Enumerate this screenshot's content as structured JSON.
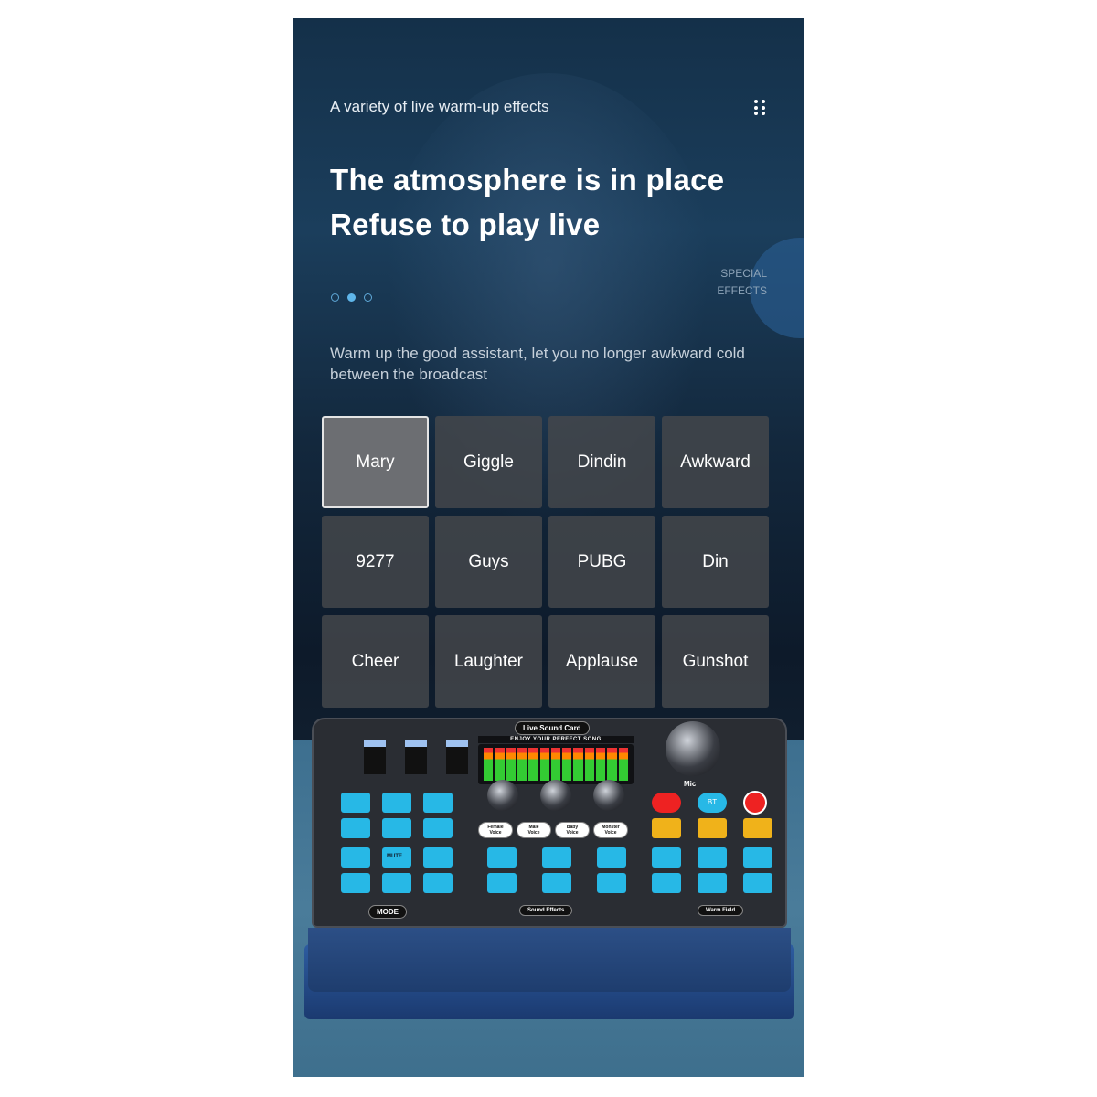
{
  "header": {
    "subtitle": "A variety of live warm-up effects",
    "menu_icon": "grid-dots-icon",
    "title_lines": [
      "The atmosphere is in place",
      "Refuse to play live"
    ],
    "side_label": [
      "SPECIAL",
      "EFFECTS"
    ],
    "carousel": {
      "count": 3,
      "active": 2
    },
    "description": "Warm up the good assistant, let you no longer awkward cold between the broadcast"
  },
  "effects": [
    {
      "label": "Mary",
      "selected": true
    },
    {
      "label": "Giggle"
    },
    {
      "label": "Dindin"
    },
    {
      "label": "Awkward"
    },
    {
      "label": "9277"
    },
    {
      "label": "Guys"
    },
    {
      "label": "PUBG"
    },
    {
      "label": "Din"
    },
    {
      "label": "Cheer"
    },
    {
      "label": "Laughter"
    },
    {
      "label": "Applause"
    },
    {
      "label": "Gunshot"
    }
  ],
  "device": {
    "name": "Live Sound Card",
    "meter_label": "ENJOY YOUR PERFECT SONG",
    "mic": "Mic",
    "bt": "BT",
    "voices": [
      "Female Voice",
      "Male Voice",
      "Baby Voice",
      "Monster Voice"
    ],
    "sections": [
      "MODE",
      "Sound Effects",
      "Warm Field"
    ],
    "mute": "MUTE",
    "colors": {
      "button": "#27b8e6",
      "transport": "#f0b21a",
      "power": "#e22222"
    }
  }
}
